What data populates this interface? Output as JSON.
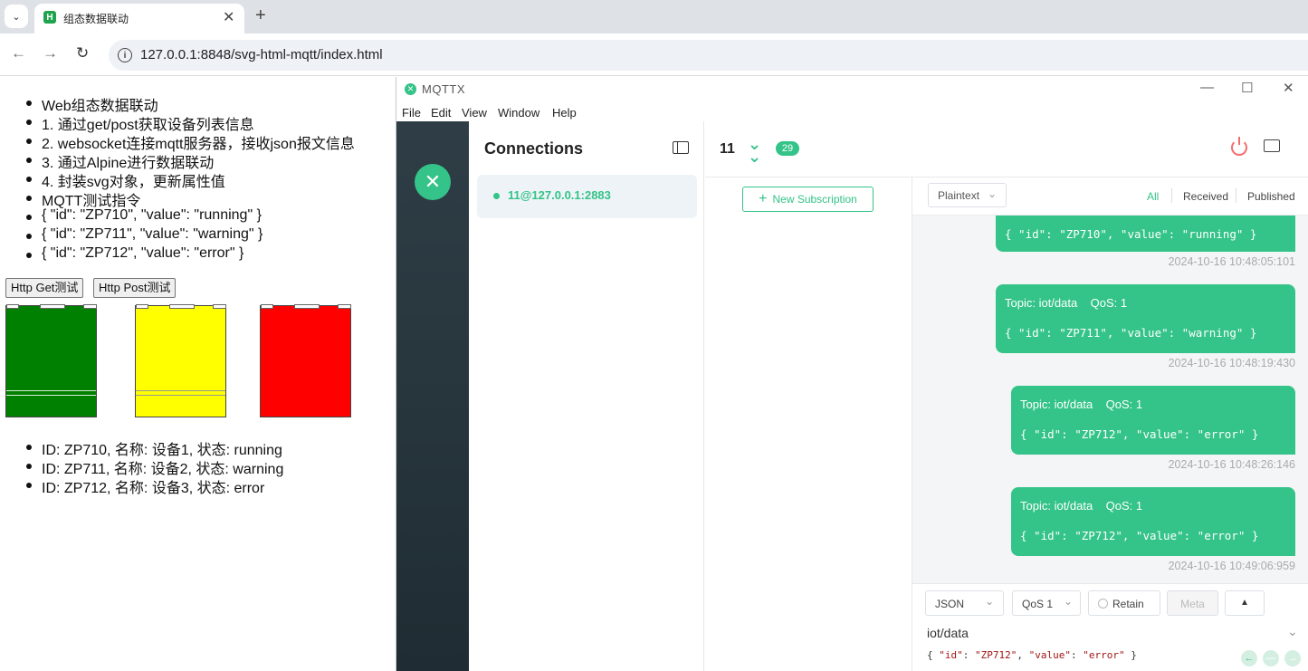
{
  "browser": {
    "tab_title": "组态数据联动",
    "favicon_letter": "H",
    "tab_close": "✕",
    "new_tab": "+",
    "url": "127.0.0.1:8848/svg-html-mqtt/index.html"
  },
  "page": {
    "bullets": [
      "Web组态数据联动",
      "1. 通过get/post获取设备列表信息",
      "2. websocket连接mqtt服务器，接收json报文信息",
      "3. 通过Alpine进行数据联动",
      "4. 封装svg对象，更新属性值",
      "MQTT测试指令",
      "{ \"id\": \"ZP710\", \"value\": \"running\" }",
      "{ \"id\": \"ZP711\", \"value\": \"warning\" }",
      "{ \"id\": \"ZP712\", \"value\": \"error\" }"
    ],
    "buttons": [
      "Http Get测试",
      "Http Post测试"
    ],
    "devices": [
      {
        "color": "#008000"
      },
      {
        "color": "#ffff00"
      },
      {
        "color": "#ff0000"
      }
    ],
    "device_list": [
      "ID: ZP710, 名称: 设备1, 状态: running",
      "ID: ZP711, 名称: 设备2, 状态: warning",
      "ID: ZP712, 名称: 设备3, 状态: error"
    ]
  },
  "mqttx": {
    "title": "MQTTX",
    "menu": [
      "File",
      "Edit",
      "View",
      "Window",
      "Help"
    ],
    "connections_title": "Connections",
    "connection_name": "11@127.0.0.1:2883",
    "header": {
      "name": "11",
      "badge": "29"
    },
    "new_subscription": "New Subscription",
    "format": "Plaintext",
    "filters": [
      "All",
      "Received",
      "Published"
    ],
    "accent": "#34c388",
    "messages": [
      {
        "topic": "",
        "qos": "",
        "payload": "{ \"id\": \"ZP710\", \"value\": \"running\" }",
        "time": "2024-10-16 10:48:05:101"
      },
      {
        "topic": "Topic: iot/data",
        "qos": "QoS: 1",
        "payload": "{ \"id\": \"ZP711\", \"value\": \"warning\" }",
        "time": "2024-10-16 10:48:19:430"
      },
      {
        "topic": "Topic: iot/data",
        "qos": "QoS: 1",
        "payload": "{ \"id\": \"ZP712\", \"value\": \"error\" }",
        "time": "2024-10-16 10:48:26:146"
      },
      {
        "topic": "Topic: iot/data",
        "qos": "QoS: 1",
        "payload": "{ \"id\": \"ZP712\", \"value\": \"error\" }",
        "time": "2024-10-16 10:49:06:959"
      }
    ],
    "editor": {
      "format": "JSON",
      "qos": "QoS 1",
      "retain": "Retain",
      "meta": "Meta",
      "topic": "iot/data",
      "payload_key1": "\"id\"",
      "payload_val1": "\"ZP712\"",
      "payload_key2": "\"value\"",
      "payload_val2": "\"error\""
    }
  }
}
